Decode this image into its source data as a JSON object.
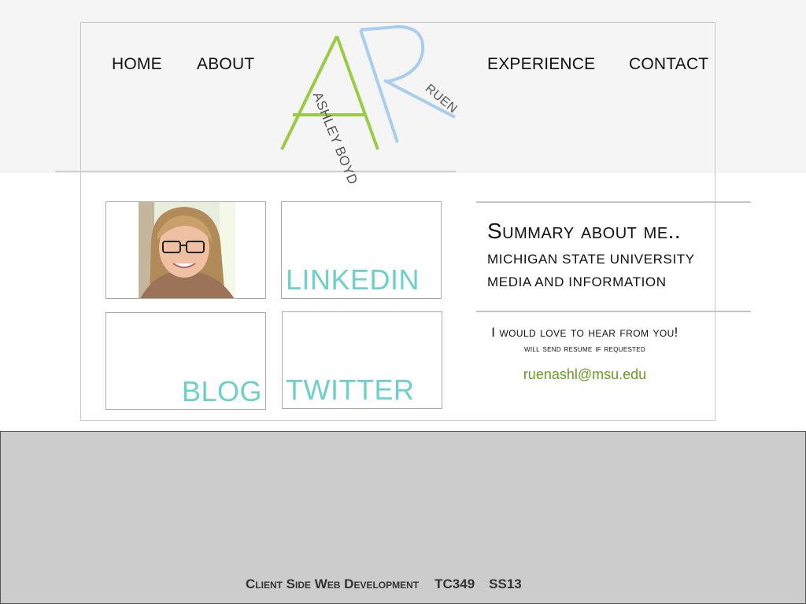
{
  "header": {
    "nav": {
      "home": "HOME",
      "about": "ABOUT",
      "experience": "EXPERIENCE",
      "contact": "CONTACT"
    },
    "logo": {
      "initials_first": "A",
      "initials_last": "R",
      "first_name": "ASHLEY BOYD",
      "last_name": "RUEN",
      "colors": {
        "a": "#99cc44",
        "r": "#a8cdee"
      }
    }
  },
  "tiles": {
    "photo_alt": "profile-photo",
    "linkedin": "LINKEDIN",
    "blog": "BLOG",
    "twitter": "TWITTER"
  },
  "summary": {
    "title": "Summary about me..",
    "line1": "MICHIGAN STATE UNIVERSITY",
    "line2": "MEDIA AND INFORMATION"
  },
  "contact": {
    "line1": "I would love to hear from you!",
    "line2": "will send resume if requested",
    "email": "ruenashl@msu.edu"
  },
  "footer": {
    "course_name": "Client Side Web Development",
    "course_code": "TC349",
    "term": "SS13"
  },
  "colors": {
    "tile_text": "#6fcfca",
    "email": "#6a9a1f",
    "header_bg": "#f5f5f5",
    "footer_bg": "#cccccc"
  }
}
